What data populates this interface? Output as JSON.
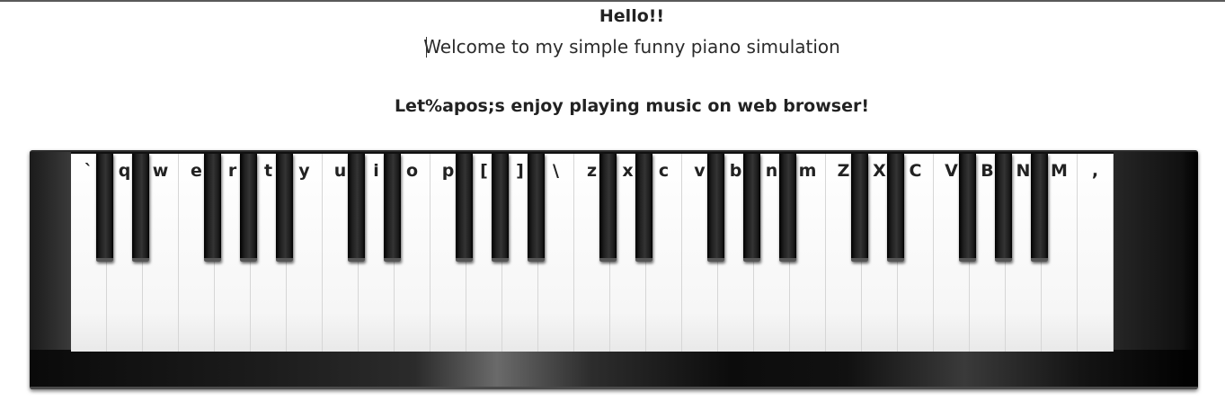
{
  "header": {
    "greeting": "Hello!!",
    "welcome": "Welcome to my simple funny piano simulation",
    "tagline": "Let%apos;s enjoy playing music on web browser!"
  },
  "piano": {
    "white_keys": [
      "`",
      "q",
      "w",
      "e",
      "r",
      "t",
      "y",
      "u",
      "i",
      "o",
      "p",
      "[",
      "]",
      "\\",
      "z",
      "x",
      "c",
      "v",
      "b",
      "n",
      "m",
      "Z",
      "X",
      "C",
      "V",
      "B",
      "N",
      "M",
      ","
    ],
    "black_key_after_white_index": [
      0,
      1,
      3,
      4,
      5,
      7,
      8,
      10,
      11,
      12,
      14,
      15,
      17,
      18,
      19,
      21,
      22,
      24,
      25,
      26
    ]
  }
}
